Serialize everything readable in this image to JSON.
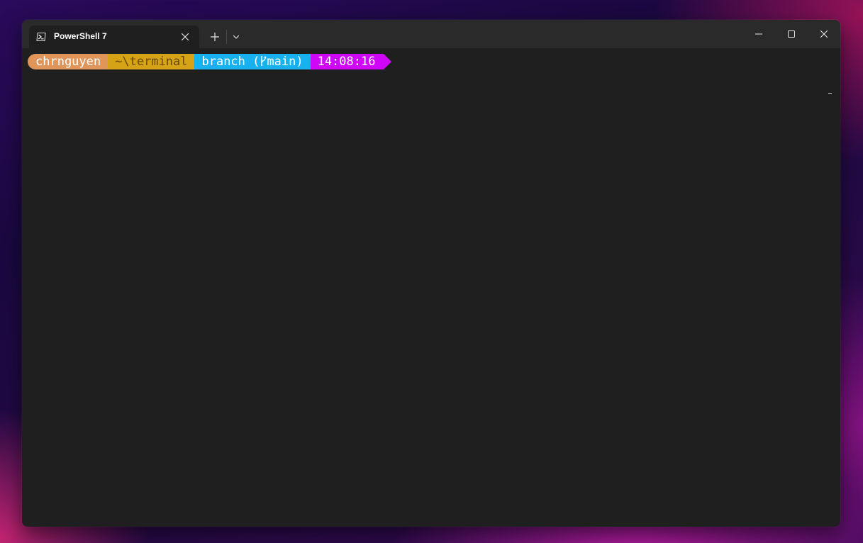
{
  "window": {
    "tab": {
      "title": "PowerShell 7",
      "icon": "powershell-icon"
    },
    "new_tab_icon": "plus-icon",
    "dropdown_icon": "chevron-down-icon",
    "controls": {
      "minimize_icon": "minimize-icon",
      "maximize_icon": "maximize-icon",
      "close_icon": "close-icon"
    }
  },
  "prompt": {
    "user": "chrnguyen",
    "path": "~\\terminal",
    "git_prefix": "branch (",
    "git_icon": "git-branch-icon",
    "git_branch": "main",
    "git_suffix": ")",
    "time": "14:08:16"
  },
  "colors": {
    "user_segment": "#e0965b",
    "path_segment": "#d7a316",
    "git_segment": "#18b1f0",
    "time_segment": "#cf06f7",
    "terminal_background": "#1f1f1f",
    "titlebar_background": "#2a2a2a"
  }
}
